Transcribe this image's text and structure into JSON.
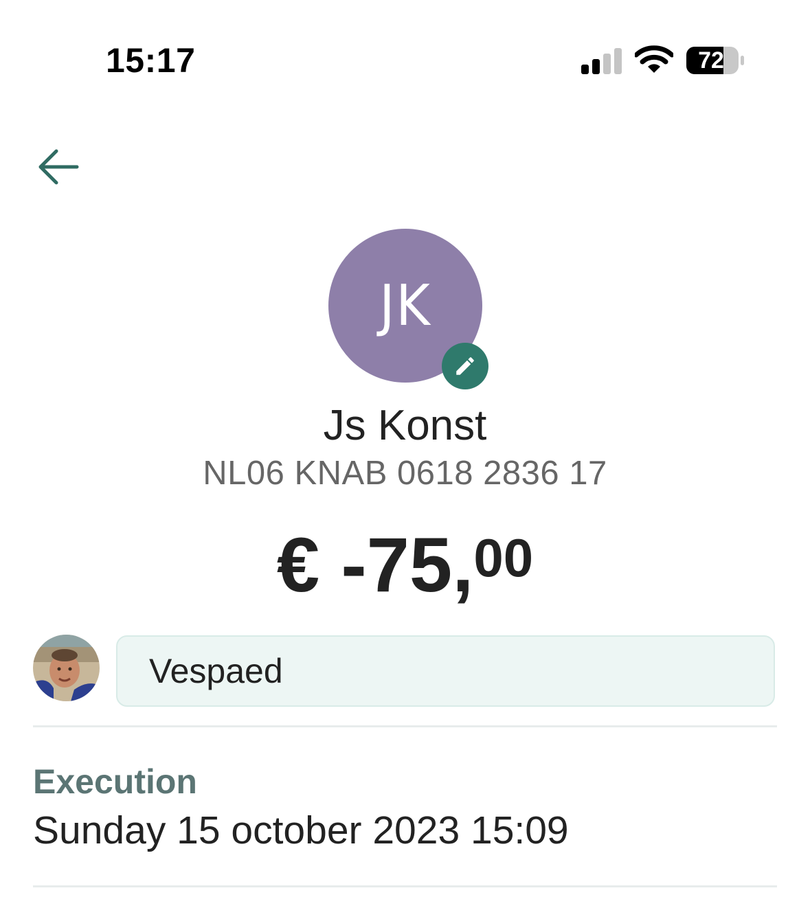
{
  "status_bar": {
    "time": "15:17",
    "battery_level": "72",
    "signal_strength": 2,
    "signal_max": 4
  },
  "navigation": {
    "back_icon": "arrow-left-icon"
  },
  "counterparty": {
    "initials": "JK",
    "name": "Js Konst",
    "iban": "NL06 KNAB 0618 2836 17",
    "edit_icon": "pencil-icon"
  },
  "transaction": {
    "amount_main": "€ -75,",
    "amount_decimals": "00",
    "description": "Vespaed",
    "execution_label": "Execution",
    "execution_value": "Sunday 15 october 2023 15:09"
  },
  "colors": {
    "accent": "#2f7a6c",
    "avatar": "#8e7fa9",
    "label": "#5b7574",
    "desc_bg": "#edf6f4"
  }
}
